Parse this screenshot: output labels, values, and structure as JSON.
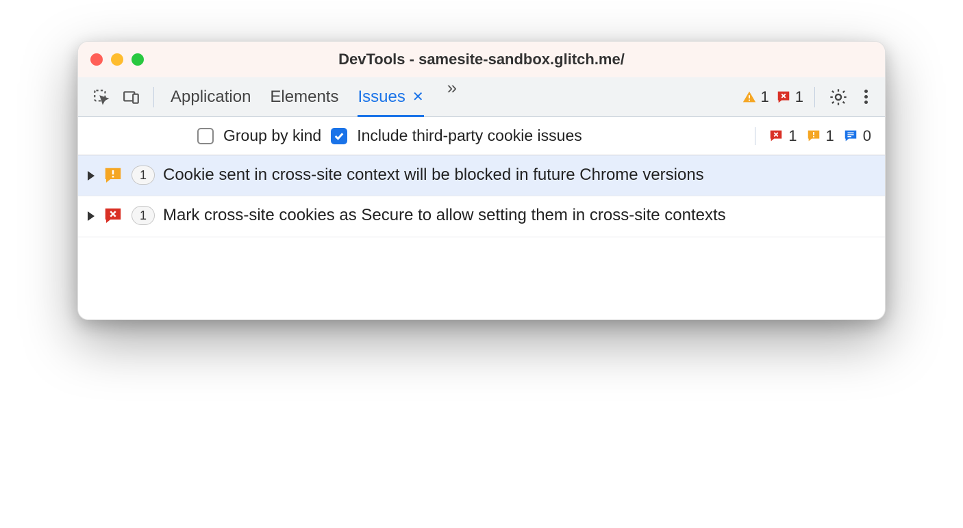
{
  "window": {
    "title": "DevTools - samesite-sandbox.glitch.me/"
  },
  "tabs": {
    "application": "Application",
    "elements": "Elements",
    "issues": "Issues"
  },
  "toolbar_counts": {
    "warnings": "1",
    "errors": "1"
  },
  "filters": {
    "group_by_kind": "Group by kind",
    "include_third_party": "Include third-party cookie issues"
  },
  "filter_counts": {
    "errors": "1",
    "warnings": "1",
    "info": "0"
  },
  "issues": [
    {
      "count": "1",
      "text": "Cookie sent in cross-site context will be blocked in future Chrome versions"
    },
    {
      "count": "1",
      "text": "Mark cross-site cookies as Secure to allow setting them in cross-site contexts"
    }
  ]
}
